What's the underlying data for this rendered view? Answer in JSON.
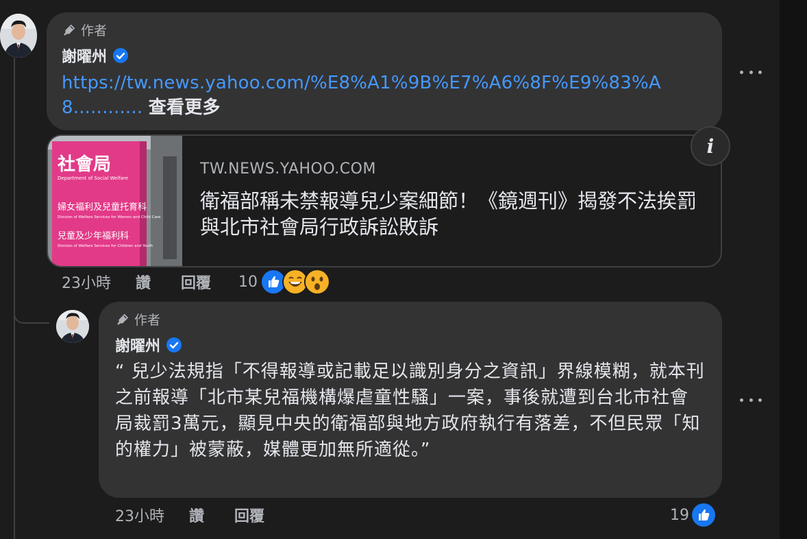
{
  "first_comment": {
    "author_badge": "作者",
    "author_name": "謝曜州",
    "link_text": "https://tw.news.yahoo.com/%E8%A1%9B%E7%A6%8F%E9%83%A8............",
    "see_more": "查看更多",
    "link_preview": {
      "domain": "TW.NEWS.YAHOO.COM",
      "title": "衛福部稱未禁報導兒少案細節！《鏡週刊》揭發不法挨罰 與北市社會局行政訴訟敗訴",
      "thumbnail_sign": {
        "main": "社會局",
        "sub": "Department of Social Welfare",
        "line1": "婦女福利及兒童托育科",
        "line1_en": "Division of Welfare Services for Women and Child Care",
        "line2": "兒童及少年福利科",
        "line2_en": "Division of Welfare Services for Children and Youth"
      }
    },
    "time": "23小時",
    "like_label": "讚",
    "reply_label": "回覆",
    "reaction_count": "10",
    "reactions": [
      "like-icon",
      "laughing-emoji-icon",
      "wow-emoji-icon"
    ]
  },
  "reply_comment": {
    "author_badge": "作者",
    "author_name": "謝曜州",
    "text": "“ 兒少法規指「不得報導或記載足以識別身分之資訊」界線模糊，就本刊之前報導「北市某兒福機構爆虐童性騷」一案，事後就遭到台北市社會局裁罰3萬元，顯見中央的衛福部與地方政府執行有落差，不但民眾「知的權力」被蒙蔽，媒體更加無所適從。”",
    "time": "23小時",
    "like_label": "讚",
    "reply_label": "回覆",
    "reaction_count": "19",
    "reactions": [
      "like-icon"
    ]
  },
  "colors": {
    "background": "#1c1c1d",
    "bubble": "#333334",
    "link": "#4599ff",
    "like_blue": "#1877f2"
  }
}
